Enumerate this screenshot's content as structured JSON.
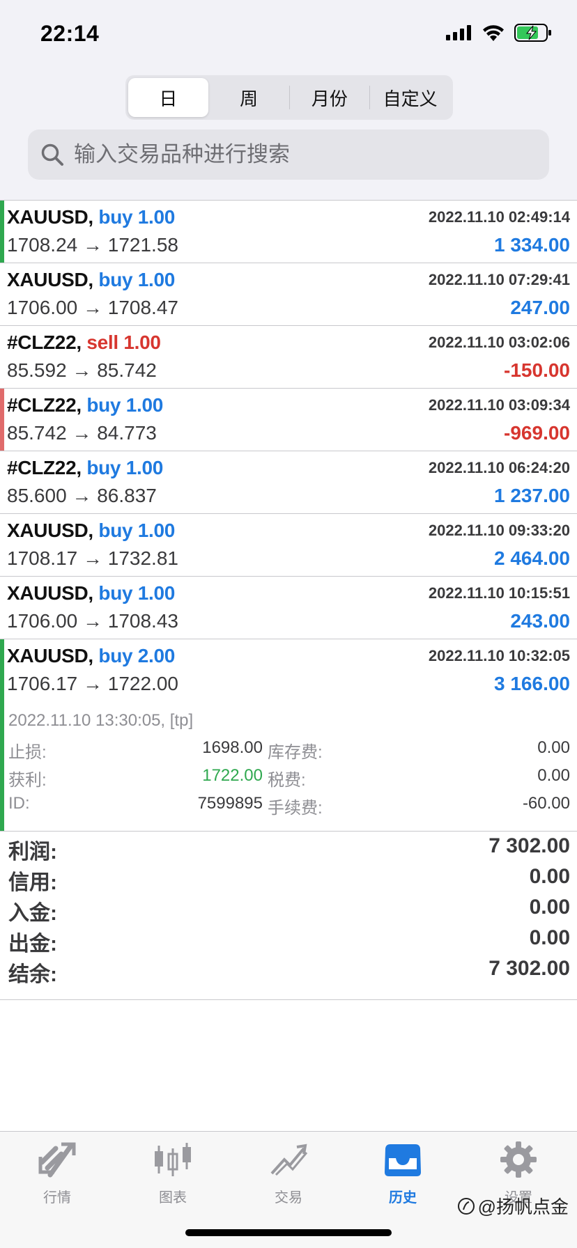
{
  "status_bar": {
    "time": "22:14"
  },
  "periods": {
    "items": [
      "日",
      "周",
      "月份",
      "自定义"
    ],
    "active_index": 0
  },
  "search": {
    "placeholder": "输入交易品种进行搜索"
  },
  "deals": [
    {
      "symbol": "XAUUSD,",
      "side": "buy",
      "volume": "1.00",
      "time": "2022.11.10 02:49:14",
      "prices": "1708.24 → 1721.58",
      "profit": "1 334.00",
      "profit_sign": "pos",
      "marker_color": "#2fa84f"
    },
    {
      "symbol": "XAUUSD,",
      "side": "buy",
      "volume": "1.00",
      "time": "2022.11.10 07:29:41",
      "prices": "1706.00 → 1708.47",
      "profit": "247.00",
      "profit_sign": "pos",
      "marker_color": ""
    },
    {
      "symbol": "#CLZ22,",
      "side": "sell",
      "volume": "1.00",
      "time": "2022.11.10 03:02:06",
      "prices": "85.592 → 85.742",
      "profit": "-150.00",
      "profit_sign": "neg",
      "marker_color": ""
    },
    {
      "symbol": "#CLZ22,",
      "side": "buy",
      "volume": "1.00",
      "time": "2022.11.10 03:09:34",
      "prices": "85.742 → 84.773",
      "profit": "-969.00",
      "profit_sign": "neg",
      "marker_color": "#e06b6b"
    },
    {
      "symbol": "#CLZ22,",
      "side": "buy",
      "volume": "1.00",
      "time": "2022.11.10 06:24:20",
      "prices": "85.600 → 86.837",
      "profit": "1 237.00",
      "profit_sign": "pos",
      "marker_color": ""
    },
    {
      "symbol": "XAUUSD,",
      "side": "buy",
      "volume": "1.00",
      "time": "2022.11.10 09:33:20",
      "prices": "1708.17 → 1732.81",
      "profit": "2 464.00",
      "profit_sign": "pos",
      "marker_color": ""
    },
    {
      "symbol": "XAUUSD,",
      "side": "buy",
      "volume": "1.00",
      "time": "2022.11.10 10:15:51",
      "prices": "1706.00 → 1708.43",
      "profit": "243.00",
      "profit_sign": "pos",
      "marker_color": ""
    }
  ],
  "expanded_deal": {
    "symbol": "XAUUSD,",
    "side": "buy",
    "volume": "2.00",
    "time": "2022.11.10 10:32:05",
    "prices": "1706.17 → 1722.00",
    "profit": "3 166.00",
    "marker_color": "#2fa84f",
    "close_info": "2022.11.10 13:30:05, [tp]",
    "stop_loss_label": "止损:",
    "stop_loss": "1698.00",
    "swap_label": "库存费:",
    "swap": "0.00",
    "take_profit_label": "获利:",
    "take_profit": "1722.00",
    "tax_label": "税费:",
    "tax": "0.00",
    "id_label": "ID:",
    "id": "7599895",
    "commission_label": "手续费:",
    "commission": "-60.00"
  },
  "summary": {
    "profit_label": "利润:",
    "profit": "7 302.00",
    "credit_label": "信用:",
    "credit": "0.00",
    "deposit_label": "入金:",
    "deposit": "0.00",
    "withdrawal_label": "出金:",
    "withdrawal": "0.00",
    "balance_label": "结余:",
    "balance": "7 302.00"
  },
  "tabbar": {
    "quotes": "行情",
    "charts": "图表",
    "trade": "交易",
    "history": "历史",
    "settings": "设置"
  },
  "watermark": "@扬帆点金",
  "colors": {
    "accent": "#1f7ae0",
    "loss": "#d7362f",
    "gain_marker": "#2fa84f"
  }
}
